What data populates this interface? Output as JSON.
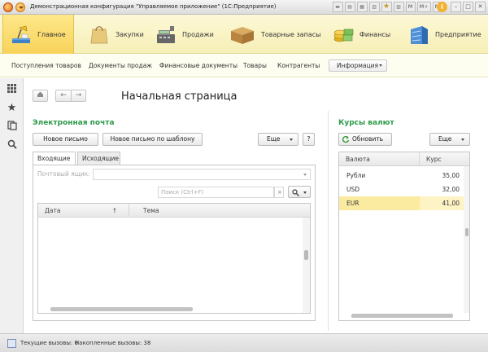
{
  "window": {
    "title": "Демонстрационная конфигурация \"Управляемое приложение\"  (1С:Предприятие)",
    "toolbar_icons": [
      "save-icon",
      "print-icon",
      "calendar-icon",
      "calculator-icon",
      "star-icon",
      "history-icon",
      "m-label",
      "m-plus-label",
      "m-minus-label"
    ],
    "m_label": "M",
    "m_plus": "M+",
    "m_minus": "M-"
  },
  "sections": [
    {
      "label": "Главное",
      "icon": "desk-lamp-icon",
      "active": true
    },
    {
      "label": "Закупки",
      "icon": "shopping-bag-icon",
      "active": false
    },
    {
      "label": "Продажи",
      "icon": "cash-register-icon",
      "active": false
    },
    {
      "label": "Товарные запасы",
      "icon": "box-icon",
      "active": false
    },
    {
      "label": "Финансы",
      "icon": "coins-icon",
      "active": false
    },
    {
      "label": "Предприятие",
      "icon": "building-icon",
      "active": false
    }
  ],
  "submenu": {
    "items": [
      "Поступления товаров",
      "Документы продаж",
      "Финансовые документы",
      "Товары",
      "Контрагенты"
    ],
    "dropdown": "Информация"
  },
  "page": {
    "title": "Начальная страница"
  },
  "email": {
    "title": "Электронная почта",
    "new_letter": "Новое письмо",
    "new_by_template": "Новое письмо по шаблону",
    "more": "Еще",
    "help": "?",
    "tabs": [
      "Входящие",
      "Исходящие"
    ],
    "mailbox_label": "Почтовый ящик:",
    "search_placeholder": "Поиск (Ctrl+F)",
    "search_clear": "×",
    "columns": {
      "date": "Дата",
      "sort_arrow": "↑",
      "subject": "Тема"
    }
  },
  "rates": {
    "title": "Курсы валют",
    "refresh": "Обновить",
    "more": "Еще",
    "columns": {
      "currency": "Валюта",
      "rate": "Курс"
    },
    "rows": [
      {
        "currency": "Рубли",
        "rate": "35,00"
      },
      {
        "currency": "USD",
        "rate": "32,00"
      },
      {
        "currency": "EUR",
        "rate": "41,00"
      }
    ],
    "selected_index": 2
  },
  "status": {
    "current_calls": "Текущие вызовы: 0",
    "accumulated_calls": "Накопленные вызовы: 38"
  }
}
